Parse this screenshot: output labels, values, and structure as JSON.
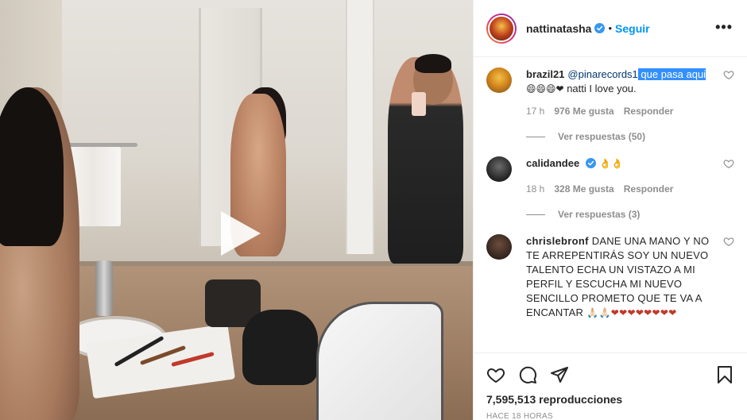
{
  "post": {
    "username": "nattinatasha",
    "verified": true,
    "dot": "•",
    "follow_label": "Seguir",
    "more_label": "•••",
    "views": "7,595,513 reproducciones",
    "timestamp": "HACE 18 HORAS"
  },
  "comments": [
    {
      "username": "brazil21",
      "mention": "@pinarecords1",
      "highlight": " que pasa aqui",
      "emoji": " 😄😄😄❤",
      "text": " natti I love you.",
      "age": "17 h",
      "likes": "976 Me gusta",
      "reply_label": "Responder",
      "replies_label": "Ver respuestas (50)"
    },
    {
      "username": "calidandee",
      "verified": true,
      "emoji": " 👌👌",
      "age": "18 h",
      "likes": "328 Me gusta",
      "reply_label": "Responder",
      "replies_label": "Ver respuestas (3)"
    },
    {
      "username": "chrislebronf",
      "text": "DANE UNA MANO Y NO TE ARREPENTIRÁS SOY UN NUEVO TALENTO ECHA UN VISTAZO A MI PERFIL Y ESCUCHA MI NUEVO SENCILLO PROMETO QUE TE VA A ENCANTAR",
      "emoji": " 🙏🏻🙏🏻❤❤❤❤❤❤❤❤"
    }
  ],
  "icons": {
    "like": "heart-icon",
    "comment": "comment-icon",
    "share": "share-icon",
    "save": "bookmark-icon",
    "play": "play-icon"
  },
  "colors": {
    "accent": "#0095f6",
    "verified": "#3897f0",
    "highlight": "#3390ff",
    "muted": "#8e8e8e",
    "text": "#262626"
  }
}
